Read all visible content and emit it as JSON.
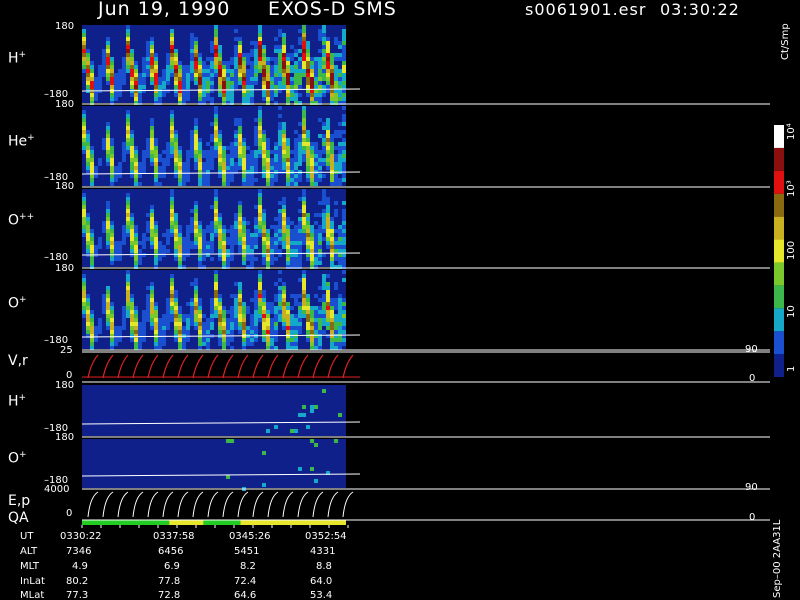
{
  "header": {
    "date": "Jun 19, 1990",
    "instrument": "EXOS-D SMS",
    "file": "s0061901.esr",
    "time": "03:30:22"
  },
  "panels": [
    {
      "label": "H",
      "charge": "+",
      "ymax": "180",
      "ymin": "–180"
    },
    {
      "label": "He",
      "charge": "+",
      "ymax": "180",
      "ymin": "–180"
    },
    {
      "label": "O",
      "charge": "++",
      "ymax": "180",
      "ymin": "–180"
    },
    {
      "label": "O",
      "charge": "+",
      "ymax": "180",
      "ymin": "–180"
    },
    {
      "label": "V,r",
      "charge": "",
      "ymax": "25",
      "ymin": "0",
      "right_top": "90",
      "right_bottom": "0"
    },
    {
      "label": "H",
      "charge": "+",
      "ymax": "180",
      "ymin": "–180"
    },
    {
      "label": "O",
      "charge": "+",
      "ymax": "180",
      "ymin": "–180"
    },
    {
      "label": "E,p",
      "charge": "",
      "ymax": "4000",
      "ymin": "0",
      "right_top": "90",
      "right_bottom": "0"
    }
  ],
  "qa_label": "QA",
  "colorbar": {
    "unit": "Ct/Smp",
    "ticks": [
      "1",
      "10",
      "100",
      "10³",
      "10⁴"
    ],
    "colors": [
      "#10208a",
      "#1a4fd0",
      "#16a8c8",
      "#3cb84a",
      "#7ac82c",
      "#e6e62a",
      "#c8b020",
      "#8a6a10",
      "#e01010",
      "#8a1010",
      "#ffffff"
    ]
  },
  "ephemeris": {
    "rows": [
      {
        "name": "UT",
        "values": [
          "0330:22",
          "0337:58",
          "0345:26",
          "0352:54"
        ]
      },
      {
        "name": "ALT",
        "values": [
          "7346",
          "6456",
          "5451",
          "4331"
        ]
      },
      {
        "name": "MLT",
        "values": [
          "4.9",
          "6.9",
          "8.2",
          "8.8"
        ]
      },
      {
        "name": "InLat",
        "values": [
          "80.2",
          "77.8",
          "72.4",
          "64.0"
        ]
      },
      {
        "name": "MLat",
        "values": [
          "77.3",
          "72.8",
          "64.6",
          "53.4"
        ]
      }
    ]
  },
  "footnote": "Sep–00  2AA31L",
  "chart_data": {
    "type": "heatmap",
    "x_axis": "UT",
    "x_ticks": [
      "0330:22",
      "0337:58",
      "0345:26",
      "0352:54"
    ],
    "color_scale": "log",
    "color_range": [
      1,
      10000
    ],
    "panels": [
      {
        "species": "H+",
        "yrange": [
          -180,
          180
        ]
      },
      {
        "species": "He+",
        "yrange": [
          -180,
          180
        ]
      },
      {
        "species": "O++",
        "yrange": [
          -180,
          180
        ]
      },
      {
        "species": "O+",
        "yrange": [
          -180,
          180
        ]
      },
      {
        "species": "V,r",
        "yrange": [
          0,
          25
        ]
      },
      {
        "species": "H+",
        "yrange": [
          -180,
          180
        ]
      },
      {
        "species": "O+",
        "yrange": [
          -180,
          180
        ]
      },
      {
        "species": "E,p",
        "yrange": [
          0,
          4000
        ]
      }
    ],
    "qa_segments": [
      {
        "color": "#22cc22",
        "from": 0,
        "to": 0.33
      },
      {
        "color": "#e6e62a",
        "from": 0.33,
        "to": 0.46
      },
      {
        "color": "#22cc22",
        "from": 0.46,
        "to": 0.6
      },
      {
        "color": "#e6e62a",
        "from": 0.6,
        "to": 1
      }
    ]
  }
}
